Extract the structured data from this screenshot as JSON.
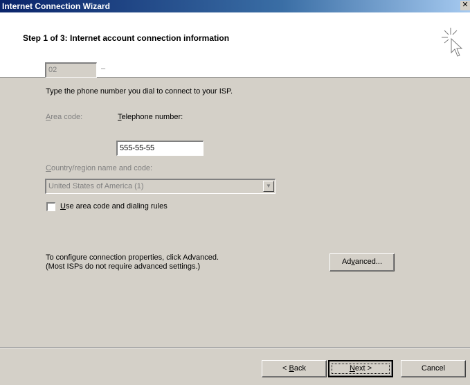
{
  "window": {
    "title": "Internet Connection Wizard",
    "close_glyph": "✕"
  },
  "header": {
    "step_title": "Step 1 of 3: Internet account connection information",
    "icon": "wizard-cursor-icon"
  },
  "content": {
    "instruction": "Type the phone number you dial to connect to your ISP.",
    "area_code": {
      "label_mnemonic": "A",
      "label_rest": "rea code:",
      "value": "02",
      "enabled": false
    },
    "dash": "–",
    "telephone": {
      "label_mnemonic": "T",
      "label_rest": "elephone number:",
      "value": "555-55-55",
      "enabled": true
    },
    "country": {
      "label_mnemonic": "C",
      "label_rest": "ountry/region name and code:",
      "selected": "United States of America (1)",
      "enabled": false
    },
    "use_dialing_rules": {
      "label_mnemonic": "U",
      "label_rest": "se area code and dialing rules",
      "checked": false
    },
    "advanced_line1": "To configure connection properties, click Advanced.",
    "advanced_line2": "(Most ISPs do not require advanced settings.)",
    "advanced_button": {
      "pre": "Ad",
      "mnemonic": "v",
      "post": "anced..."
    }
  },
  "footer": {
    "back": {
      "pre": "< ",
      "mnemonic": "B",
      "post": "ack"
    },
    "next": {
      "pre": "",
      "mnemonic": "N",
      "post": "ext >"
    },
    "cancel": "Cancel"
  },
  "colors": {
    "face": "#d4d0c8",
    "titlebar": "#0a246a",
    "disabled_text": "#808080"
  }
}
